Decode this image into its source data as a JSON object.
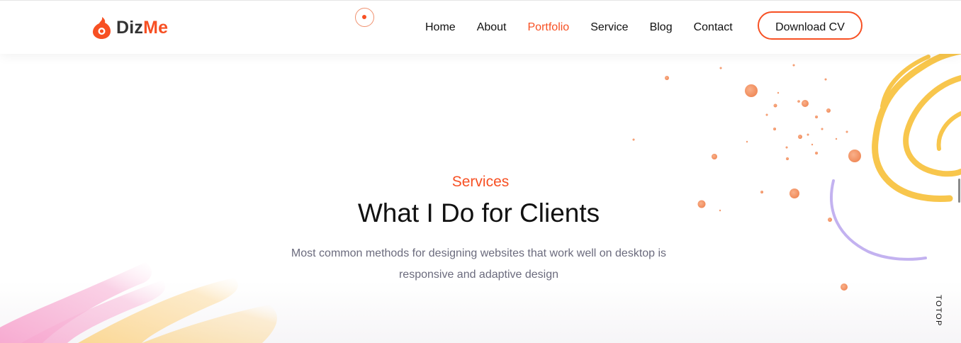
{
  "brand": {
    "name_part1": "Diz",
    "name_part2": "Me",
    "accent_color": "#f75023"
  },
  "nav": {
    "items": [
      {
        "label": "Home",
        "active": false
      },
      {
        "label": "About",
        "active": false
      },
      {
        "label": "Portfolio",
        "active": true
      },
      {
        "label": "Service",
        "active": false
      },
      {
        "label": "Blog",
        "active": false
      },
      {
        "label": "Contact",
        "active": false
      }
    ],
    "download_label": "Download CV"
  },
  "services": {
    "eyebrow": "Services",
    "title": "What I Do for Clients",
    "description": "Most common methods for designing websites that work well on desktop is responsive and adaptive design"
  },
  "to_top_label": "TOTOP",
  "icons": {
    "logo": "flame-logo-icon",
    "cursor": "cursor-ring-icon"
  }
}
